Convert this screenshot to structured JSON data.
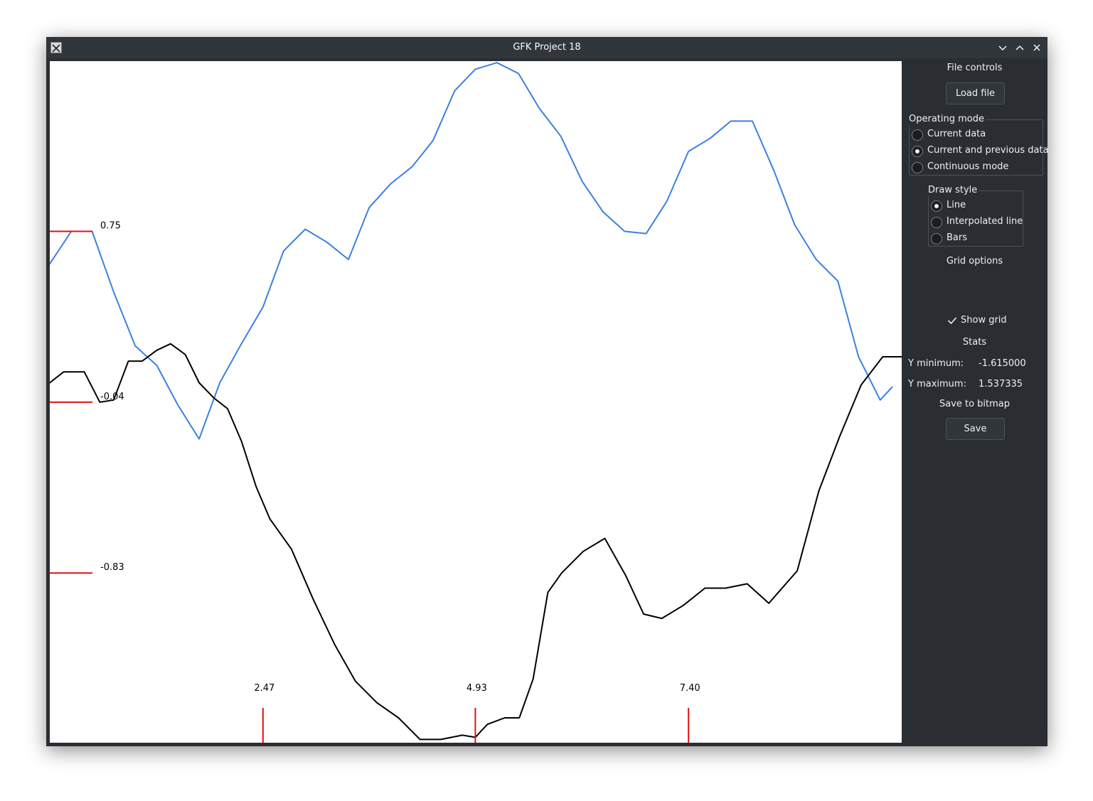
{
  "window": {
    "title": "GFK Project 18"
  },
  "panel": {
    "file_controls": {
      "heading": "File controls",
      "load_label": "Load file"
    },
    "operating_mode": {
      "title": "Operating mode",
      "options": [
        "Current data",
        "Current and previous data",
        "Continuous mode"
      ],
      "selected": 1
    },
    "draw_style": {
      "title": "Draw style",
      "options": [
        "Line",
        "Interpolated line",
        "Bars"
      ],
      "selected": 0
    },
    "grid_options": {
      "heading": "Grid options",
      "show_grid_label": "Show grid",
      "show_grid_checked": true
    },
    "stats": {
      "heading": "Stats",
      "y_min_label": "Y minimum:",
      "y_min_value": "-1.615000",
      "y_max_label": "Y maximum:",
      "y_max_value": "1.537335"
    },
    "save_to_bitmap": {
      "heading": "Save to bitmap",
      "save_label": "Save"
    }
  },
  "chart_data": {
    "type": "line",
    "xlim": [
      0,
      9.87
    ],
    "ylim": [
      -1.615,
      1.537335
    ],
    "x_ticks": [
      2.47,
      4.93,
      7.4
    ],
    "x_tick_labels": [
      "2.47",
      "4.93",
      "7.40"
    ],
    "y_ticks": [
      0.75,
      -0.04,
      -0.83
    ],
    "y_tick_labels": [
      "0.75",
      "-0.04",
      "-0.83"
    ],
    "grid": false,
    "colors": {
      "current": "#000000",
      "previous": "#3c80e0",
      "ticks": "#e01010"
    },
    "series": [
      {
        "color": "#000000",
        "x": [
          0,
          0.16,
          0.4,
          0.58,
          0.74,
          0.91,
          1.07,
          1.24,
          1.4,
          1.57,
          1.73,
          1.9,
          2.06,
          2.22,
          2.39,
          2.55,
          2.8,
          3.05,
          3.3,
          3.54,
          3.79,
          4.04,
          4.29,
          4.53,
          4.78,
          4.93,
          5.07,
          5.27,
          5.44,
          5.6,
          5.77,
          5.93,
          6.18,
          6.43,
          6.67,
          6.88,
          7.09,
          7.34,
          7.59,
          7.83,
          8.08,
          8.33,
          8.66,
          8.91,
          9.15,
          9.4,
          9.65,
          9.87
        ],
        "y": [
          0.05,
          0.1,
          0.1,
          -0.04,
          -0.03,
          0.15,
          0.15,
          0.2,
          0.23,
          0.18,
          0.05,
          -0.02,
          -0.07,
          -0.22,
          -0.43,
          -0.58,
          -0.72,
          -0.95,
          -1.16,
          -1.33,
          -1.43,
          -1.5,
          -1.6,
          -1.6,
          -1.58,
          -1.59,
          -1.53,
          -1.5,
          -1.5,
          -1.32,
          -0.92,
          -0.83,
          -0.73,
          -0.67,
          -0.84,
          -1.02,
          -1.04,
          -0.98,
          -0.9,
          -0.9,
          -0.88,
          -0.97,
          -0.82,
          -0.45,
          -0.2,
          0.04,
          0.17,
          0.17
        ]
      },
      {
        "color": "#3c80e0",
        "x": [
          0,
          0.25,
          0.49,
          0.74,
          0.99,
          1.24,
          1.48,
          1.73,
          1.97,
          2.22,
          2.47,
          2.71,
          2.96,
          3.21,
          3.46,
          3.7,
          3.95,
          4.2,
          4.44,
          4.69,
          4.93,
          5.18,
          5.43,
          5.67,
          5.92,
          6.17,
          6.41,
          6.66,
          6.91,
          7.15,
          7.4,
          7.65,
          7.89,
          8.14,
          8.39,
          8.63,
          8.88,
          9.13,
          9.37,
          9.62,
          9.76
        ],
        "y": [
          0.6,
          0.75,
          0.75,
          0.47,
          0.22,
          0.13,
          -0.05,
          -0.21,
          0.05,
          0.23,
          0.4,
          0.66,
          0.76,
          0.7,
          0.62,
          0.86,
          0.97,
          1.05,
          1.17,
          1.4,
          1.5,
          1.53,
          1.48,
          1.32,
          1.19,
          0.98,
          0.84,
          0.75,
          0.74,
          0.89,
          1.12,
          1.18,
          1.26,
          1.26,
          1.03,
          0.78,
          0.62,
          0.52,
          0.17,
          -0.03,
          0.03
        ]
      }
    ]
  }
}
